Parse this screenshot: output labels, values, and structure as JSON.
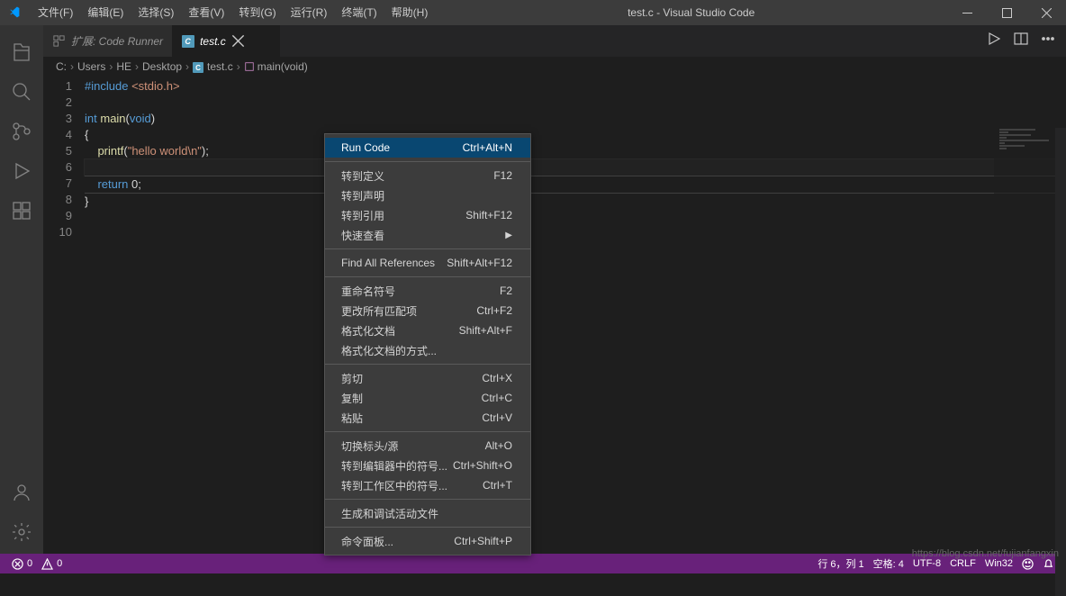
{
  "titlebar": {
    "menus": [
      "文件(F)",
      "编辑(E)",
      "选择(S)",
      "查看(V)",
      "转到(G)",
      "运行(R)",
      "终端(T)",
      "帮助(H)"
    ],
    "title": "test.c - Visual Studio Code"
  },
  "tabs": {
    "items": [
      {
        "label": "扩展: Code Runner",
        "icon": "plugin"
      },
      {
        "label": "test.c",
        "icon": "c",
        "active": true
      }
    ]
  },
  "breadcrumb": {
    "parts": [
      "C:",
      "Users",
      "HE",
      "Desktop",
      "test.c",
      "main(void)"
    ]
  },
  "code": {
    "lines": [
      {
        "n": "1",
        "tokens": [
          {
            "t": "#include",
            "c": "kw"
          },
          {
            "t": " ",
            "c": "ps"
          },
          {
            "t": "<stdio.h>",
            "c": "str"
          }
        ]
      },
      {
        "n": "2",
        "tokens": []
      },
      {
        "n": "3",
        "tokens": [
          {
            "t": "int",
            "c": "kw"
          },
          {
            "t": " ",
            "c": "ps"
          },
          {
            "t": "main",
            "c": "id"
          },
          {
            "t": "(",
            "c": "ps"
          },
          {
            "t": "void",
            "c": "kw"
          },
          {
            "t": ")",
            "c": "ps"
          }
        ]
      },
      {
        "n": "4",
        "tokens": [
          {
            "t": "{",
            "c": "ps"
          }
        ]
      },
      {
        "n": "5",
        "tokens": [
          {
            "t": "    ",
            "c": "ps"
          },
          {
            "t": "printf",
            "c": "id"
          },
          {
            "t": "(",
            "c": "ps"
          },
          {
            "t": "\"hello world\\n\"",
            "c": "str"
          },
          {
            "t": ");",
            "c": "ps"
          }
        ]
      },
      {
        "n": "6",
        "tokens": [],
        "cur": true
      },
      {
        "n": "7",
        "tokens": [
          {
            "t": "    ",
            "c": "ps"
          },
          {
            "t": "return",
            "c": "kw"
          },
          {
            "t": " ",
            "c": "ps"
          },
          {
            "t": "0",
            "c": "ab"
          },
          {
            "t": ";",
            "c": "ps"
          }
        ],
        "hl": true
      },
      {
        "n": "8",
        "tokens": [
          {
            "t": "}",
            "c": "ps"
          }
        ]
      },
      {
        "n": "9",
        "tokens": []
      },
      {
        "n": "10",
        "tokens": []
      }
    ]
  },
  "context_menu": {
    "groups": [
      [
        {
          "label": "Run Code",
          "shortcut": "Ctrl+Alt+N",
          "sel": true
        }
      ],
      [
        {
          "label": "转到定义",
          "shortcut": "F12"
        },
        {
          "label": "转到声明",
          "shortcut": ""
        },
        {
          "label": "转到引用",
          "shortcut": "Shift+F12"
        },
        {
          "label": "快速查看",
          "shortcut": "",
          "arrow": true
        }
      ],
      [
        {
          "label": "Find All References",
          "shortcut": "Shift+Alt+F12"
        }
      ],
      [
        {
          "label": "重命名符号",
          "shortcut": "F2"
        },
        {
          "label": "更改所有匹配项",
          "shortcut": "Ctrl+F2"
        },
        {
          "label": "格式化文档",
          "shortcut": "Shift+Alt+F"
        },
        {
          "label": "格式化文档的方式...",
          "shortcut": ""
        }
      ],
      [
        {
          "label": "剪切",
          "shortcut": "Ctrl+X"
        },
        {
          "label": "复制",
          "shortcut": "Ctrl+C"
        },
        {
          "label": "粘贴",
          "shortcut": "Ctrl+V"
        }
      ],
      [
        {
          "label": "切换标头/源",
          "shortcut": "Alt+O"
        },
        {
          "label": "转到编辑器中的符号...",
          "shortcut": "Ctrl+Shift+O"
        },
        {
          "label": "转到工作区中的符号...",
          "shortcut": "Ctrl+T"
        }
      ],
      [
        {
          "label": "生成和调试活动文件",
          "shortcut": ""
        }
      ],
      [
        {
          "label": "命令面板...",
          "shortcut": "Ctrl+Shift+P"
        }
      ]
    ]
  },
  "statusbar": {
    "errors": "0",
    "warnings": "0",
    "cursor": "行 6，列 1",
    "spaces": "空格: 4",
    "encoding": "UTF-8",
    "eol": "CRLF",
    "lang": "Win32",
    "watermark": "https://blog.csdn.net/fujianfangxin"
  }
}
